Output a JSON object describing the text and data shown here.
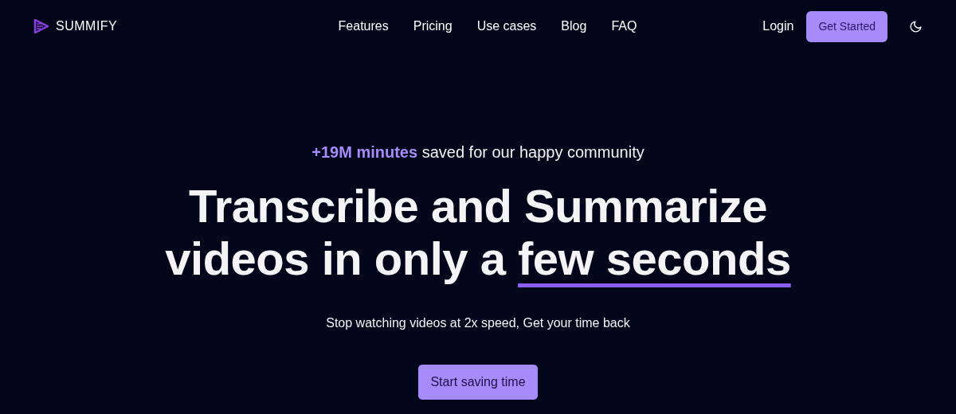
{
  "brand": {
    "name": "SUMMIFY"
  },
  "nav": [
    {
      "label": "Features"
    },
    {
      "label": "Pricing"
    },
    {
      "label": "Use cases"
    },
    {
      "label": "Blog"
    },
    {
      "label": "FAQ"
    }
  ],
  "actions": {
    "login": "Login",
    "cta": "Get Started"
  },
  "hero": {
    "tagline": "**+19M minutes** saved for our happy community",
    "headline": "Transcribe and Summarize videos in only a ",
    "headline_highlight": "few seconds",
    "subtitle": "Stop watching videos at 2x speed, Get your time back",
    "button": "Start saving time"
  }
}
